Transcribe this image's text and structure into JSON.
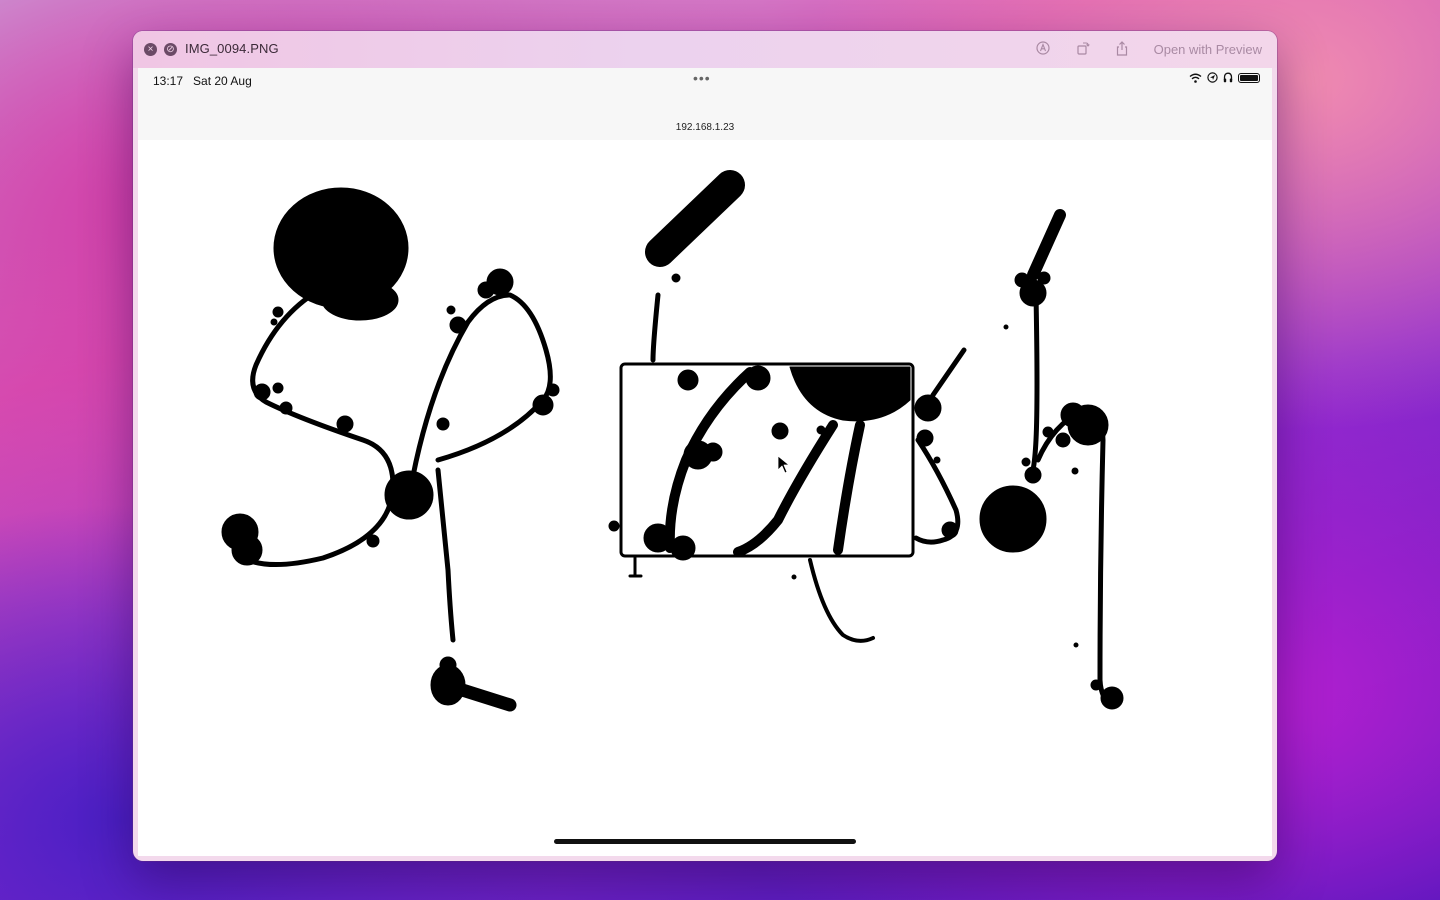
{
  "window": {
    "title": "IMG_0094.PNG",
    "open_button_label": "Open with Preview",
    "toolbar_icons": [
      "markup-icon",
      "rotate-icon",
      "share-icon"
    ]
  },
  "device_status": {
    "time_date": "13:17   Sat 20 Aug",
    "address": "192.168.1.23",
    "icons": [
      "wifi-icon",
      "location-icon",
      "headphones-icon",
      "battery-icon"
    ]
  },
  "colors": {
    "ink": "#000000",
    "canvas": "#ffffff",
    "titlebar": "#f0c6e4"
  }
}
